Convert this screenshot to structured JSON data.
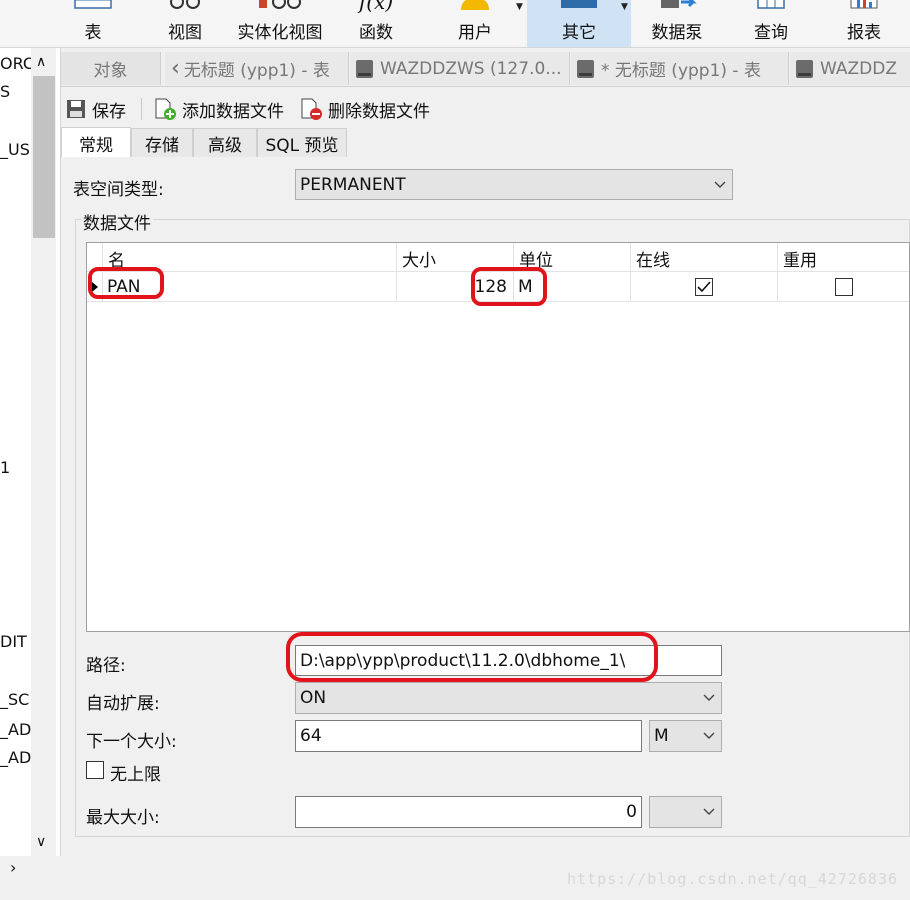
{
  "ribbon": {
    "buttons": [
      {
        "label": "表",
        "icon": "table-icon"
      },
      {
        "label": "视图",
        "icon": "view-icon"
      },
      {
        "label": "实体化视图",
        "icon": "materialized-view-icon"
      },
      {
        "label": "函数",
        "icon": "function-icon"
      },
      {
        "label": "用户",
        "icon": "user-icon"
      },
      {
        "label": "其它",
        "icon": "other-icon"
      },
      {
        "label": "数据泵",
        "icon": "data-pump-icon"
      },
      {
        "label": "查询",
        "icon": "query-icon"
      },
      {
        "label": "报表",
        "icon": "report-icon"
      }
    ],
    "function_glyph": "f(x)",
    "active": "其它",
    "accent": "#cfe3f5"
  },
  "left_panel": {
    "items": [
      "ORC",
      "S",
      "_USE",
      "1",
      "DIT",
      "_SC",
      "_AD",
      "_AD"
    ]
  },
  "tabs": {
    "objects": "对象",
    "documents": [
      "无标题 (ypp1) - 表",
      "WAZDDZWS (127.0...",
      "* 无标题 (ypp1) - 表",
      "WAZDDZ"
    ]
  },
  "toolbar": {
    "save": "保存",
    "add_datafile": "添加数据文件",
    "delete_datafile": "删除数据文件"
  },
  "inner_tabs": [
    "常规",
    "存储",
    "高级",
    "SQL 预览"
  ],
  "form": {
    "tablespace_type_label": "表空间类型:",
    "tablespace_type_value": "PERMANENT",
    "datafiles_group": "数据文件",
    "path_label": "路径:",
    "path_value": "D:\\app\\ypp\\product\\11.2.0\\dbhome_1\\",
    "autoextend_label": "自动扩展:",
    "autoextend_value": "ON",
    "next_size_label": "下一个大小:",
    "next_size_value": "64",
    "next_size_unit": "M",
    "unlimited_label": "无上限",
    "max_size_label": "最大大小:",
    "max_size_value": "0"
  },
  "grid": {
    "headers": [
      "名",
      "大小",
      "单位",
      "在线",
      "重用"
    ],
    "rows": [
      {
        "name": "PAN",
        "size": "128",
        "unit": "M",
        "online": true,
        "reuse": false
      }
    ]
  },
  "watermark": "https://blog.csdn.net/qq_42726836",
  "annotation_color": "#e0141a"
}
